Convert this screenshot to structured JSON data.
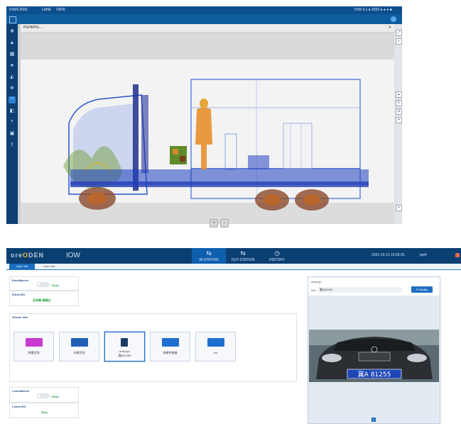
{
  "xray": {
    "window_title": "IOWS-RDS",
    "menu_items": [
      "LANE",
      "VIEW"
    ],
    "window_right": "IOW 3.x ● 2020 ● ● ● ■",
    "tab_title": "PGHRPG-..."
  },
  "iow": {
    "brand_left": "ore",
    "brand_accent": "O",
    "brand_right": "DEN",
    "app_title": "IOW",
    "nav": [
      {
        "label": "IN-STATION",
        "icon": "in-station-icon"
      },
      {
        "label": "OUT-STATION",
        "icon": "out-station-icon"
      },
      {
        "label": "HISTORY",
        "icon": "history-icon"
      }
    ],
    "datetime": "2020-10-13 10:58:26",
    "user": "ppt4",
    "lane_tabs": [
      "Lane Info",
      "Lane Info"
    ],
    "enter_barrier": {
      "title": "EnterBarrier",
      "status": "Close"
    },
    "enter_led": {
      "title": "EnterLED",
      "status": "无车辆 请通过"
    },
    "sensors_title": "Sensor Info",
    "sensors": [
      {
        "label": "称重识别",
        "sub": "",
        "color": "#c93bd0"
      },
      {
        "label": "车辆识别",
        "sub": "",
        "color": "#1f5fb8"
      },
      {
        "label": "entry-lpr",
        "sub": "冀A81255",
        "color": "#1a3b66"
      },
      {
        "label": "地感传感器",
        "sub": "",
        "color": "#1f6fd0"
      },
      {
        "label": "rsu",
        "sub": "",
        "color": "#1f6fd0"
      }
    ],
    "leave_barrier": {
      "title": "LeaveBarrier",
      "status": "Close"
    },
    "leave_led": {
      "title": "LeaveLED",
      "status": "Stop"
    },
    "entry_panel": {
      "title": "entry-lpr",
      "info_label": "Info:",
      "info_value": "冀A81255",
      "modify_label": "Modify",
      "plate": "冀A 81255",
      "page": "1"
    }
  }
}
